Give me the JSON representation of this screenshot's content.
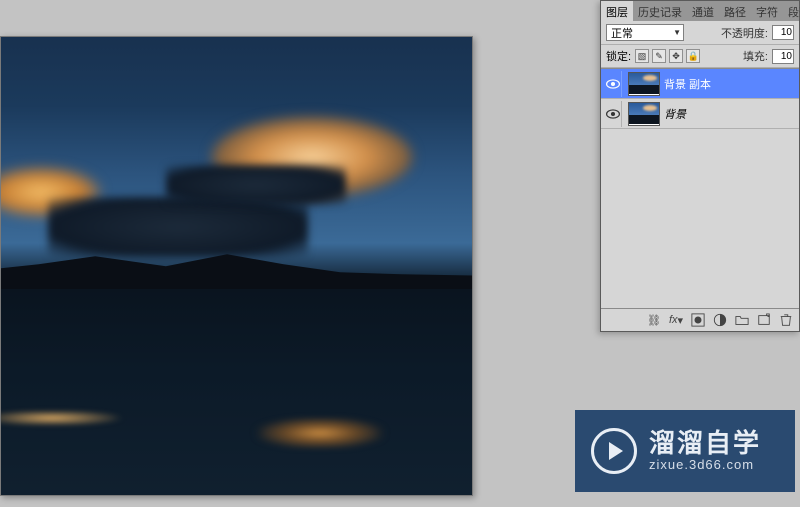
{
  "panel": {
    "tabs": [
      "图层",
      "历史记录",
      "通道",
      "路径",
      "字符",
      "段落"
    ],
    "active_tab": "图层",
    "blend_mode": "正常",
    "opacity_label": "不透明度:",
    "opacity_value": "10",
    "lock_label": "锁定:",
    "fill_label": "填充:",
    "fill_value": "10"
  },
  "layers": [
    {
      "name": "背景 副本",
      "visible": true,
      "selected": true,
      "isBackground": false
    },
    {
      "name": "背景",
      "visible": true,
      "selected": false,
      "isBackground": true
    }
  ],
  "footer_icons": [
    "link",
    "fx",
    "mask",
    "adjust",
    "group",
    "new",
    "trash"
  ],
  "badge": {
    "title": "溜溜自学",
    "sub": "zixue.3d66.com"
  }
}
